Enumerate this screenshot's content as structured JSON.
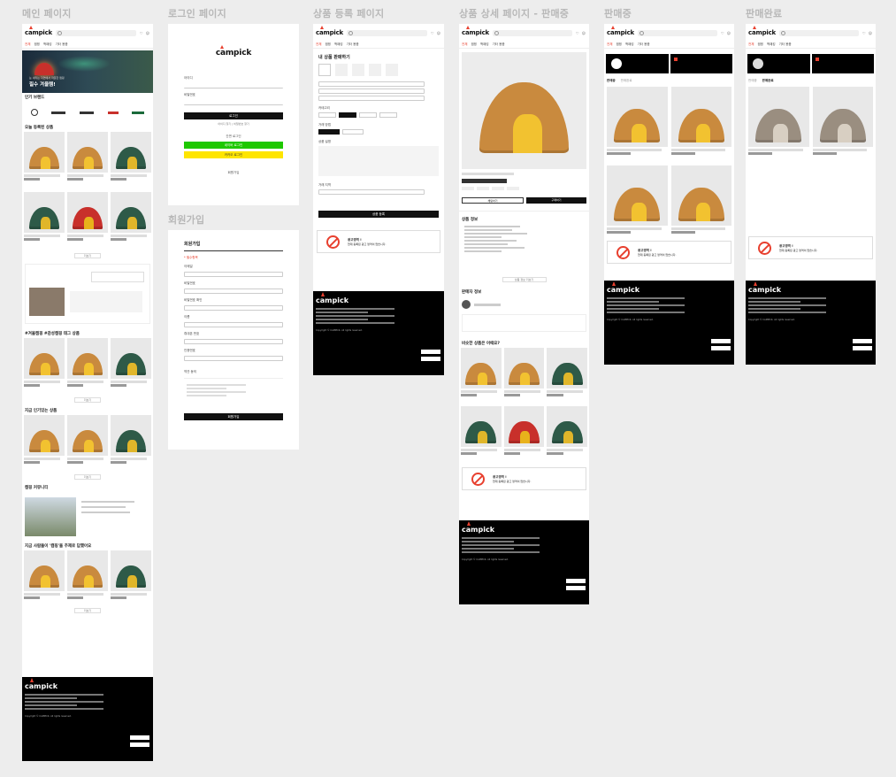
{
  "frames": {
    "main": "메인 페이지",
    "login": "로그인 페이지",
    "signup": "회원가입",
    "register": "상품 등록 페이지",
    "detail": "상품 상세 페이지 - 판매중",
    "selling": "판매중",
    "sold": "판매완료"
  },
  "brand": {
    "logo": "campick",
    "accent": "#e8402f"
  },
  "nav": [
    "전체",
    "캠핑",
    "백패킹",
    "기타 용품"
  ],
  "main": {
    "banner_title": "필수 겨울템!",
    "banner_sub": "눈 내리는 자연에서 따뜻한 캠핑",
    "sections": [
      "인기 브랜드",
      "오늘 등록된 상품",
      "#겨울캠핑 #감성캠핑 태그 상품",
      "지금 인기있는 상품",
      "캠핑 커뮤니티",
      "지금 사람들이 '캠핑'을 주제로 답했어요"
    ],
    "more": "더보기"
  },
  "login": {
    "id_label": "아이디",
    "pw_label": "비밀번호",
    "login_btn": "로그인",
    "links": "아이디 찾기 | 비밀번호 찾기",
    "sns": "간편 로그인",
    "naver": "네이버 로그인",
    "kakao": "카카오 로그인",
    "join": "회원가입"
  },
  "signup": {
    "title": "회원가입",
    "required": "* 필수항목",
    "fields": [
      "이메일",
      "비밀번호",
      "비밀번호 확인",
      "이름",
      "휴대폰 번호",
      "인증번호"
    ],
    "terms": "약관 동의",
    "submit": "회원가입"
  },
  "register": {
    "title": "내 상품 판매하기",
    "sections": [
      "카테고리",
      "거래 방법",
      "상품 설명",
      "거래 지역"
    ],
    "submit": "상품 등록"
  },
  "detail": {
    "info_title": "상품 정보",
    "seller_title": "판매자 정보",
    "similar_title": "비슷한 상품은 어때요?",
    "buy": "구매하기",
    "chat": "채팅하기",
    "fold": "상품 정보 더보기"
  },
  "notice": {
    "title": "광고영역 !",
    "text": "현재 등록된 광고 영역이 없습니다."
  },
  "selling": {
    "tab": "판매중",
    "tab2": "판매완료"
  },
  "sold": {
    "tab": "판매완료"
  },
  "footer": {
    "copyright": "Copyright © CAMPICK. All rights reserved."
  }
}
